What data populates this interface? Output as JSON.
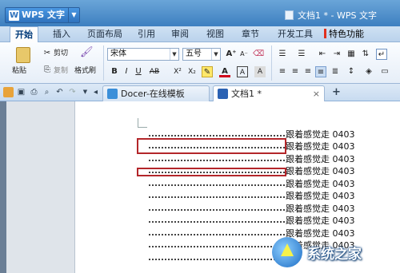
{
  "app": {
    "button_label": "WPS 文字",
    "window_title": "文档1 * - WPS 文字"
  },
  "menu": {
    "items": [
      "开始",
      "插入",
      "页面布局",
      "引用",
      "审阅",
      "视图",
      "章节",
      "开发工具",
      "特色功能"
    ],
    "active_index": 0
  },
  "ribbon": {
    "paste_label": "粘贴",
    "cut_label": "剪切",
    "copy_label": "复制",
    "format_painter_label": "格式刷",
    "font_name": "宋体",
    "font_size": "五号",
    "bold": "B",
    "italic": "I",
    "underline": "U",
    "strikethrough": "AB",
    "superscript": "X²",
    "subscript": "X₂",
    "font_color": "A",
    "grow_font": "A⁺",
    "shrink_font": "A⁻",
    "char_border": "A"
  },
  "tabs": [
    {
      "label": "Docer-在线模板",
      "icon": "docer-icon"
    },
    {
      "label": "文档1 *",
      "icon": "document-icon",
      "close": "×"
    }
  ],
  "new_tab_label": "+",
  "document": {
    "lines": [
      "跟着感觉走 0403",
      "跟着感觉走 0403",
      "跟着感觉走 0403",
      "跟着感觉走 0403",
      "跟着感觉走 0403",
      "跟着感觉走 0403",
      "跟着感觉走 0403",
      "跟着感觉走 0403",
      "跟着感觉走 0403",
      "跟着感觉走 0403"
    ],
    "highlight_color": "#b3262a"
  },
  "watermark": {
    "text": "系统之家"
  },
  "colors": {
    "titlebar": "#3d7fc0",
    "accent": "#2f72bd",
    "special_marker": "#e0301e"
  }
}
